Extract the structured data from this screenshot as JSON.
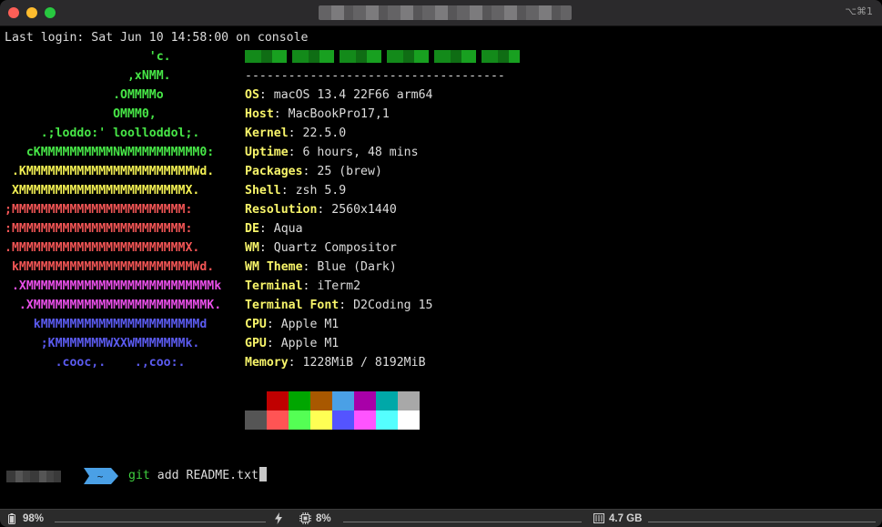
{
  "titlebar": {
    "shortcut": "⌥⌘1"
  },
  "terminal": {
    "login_line": "Last login: Sat Jun 10 14:58:00 on console",
    "logo": [
      {
        "text": "                    'c.",
        "color": "#47e647"
      },
      {
        "text": "                 ,xNMM.",
        "color": "#47e647"
      },
      {
        "text": "               .OMMMMo",
        "color": "#47e647"
      },
      {
        "text": "               OMMM0,",
        "color": "#47e647"
      },
      {
        "text": "     .;loddo:' loolloddol;.",
        "color": "#47e647"
      },
      {
        "text": "   cKMMMMMMMMMMNWMMMMMMMMMM0:",
        "color": "#47e647"
      },
      {
        "text": " .KMMMMMMMMMMMMMMMMMMMMMMMWd.",
        "color": "#f2ef52"
      },
      {
        "text": " XMMMMMMMMMMMMMMMMMMMMMMMX.",
        "color": "#f2ef52"
      },
      {
        "text": ";MMMMMMMMMMMMMMMMMMMMMMMM:",
        "color": "#f25555"
      },
      {
        "text": ":MMMMMMMMMMMMMMMMMMMMMMMM:",
        "color": "#f25555"
      },
      {
        "text": ".MMMMMMMMMMMMMMMMMMMMMMMMX.",
        "color": "#f25555"
      },
      {
        "text": " kMMMMMMMMMMMMMMMMMMMMMMMMWd.",
        "color": "#f25555"
      },
      {
        "text": " .XMMMMMMMMMMMMMMMMMMMMMMMMMMk",
        "color": "#e84fe8"
      },
      {
        "text": "  .XMMMMMMMMMMMMMMMMMMMMMMMMK.",
        "color": "#e84fe8"
      },
      {
        "text": "    kMMMMMMMMMMMMMMMMMMMMMMd",
        "color": "#5b5bf0"
      },
      {
        "text": "     ;KMMMMMMMWXXWMMMMMMMk.",
        "color": "#5b5bf0"
      },
      {
        "text": "       .cooc,.    .,coo:.",
        "color": "#5b5bf0"
      }
    ],
    "separator": "------------------------------------",
    "info": [
      {
        "key": "OS",
        "value": "macOS 13.4 22F66 arm64"
      },
      {
        "key": "Host",
        "value": "MacBookPro17,1"
      },
      {
        "key": "Kernel",
        "value": "22.5.0"
      },
      {
        "key": "Uptime",
        "value": "6 hours, 48 mins"
      },
      {
        "key": "Packages",
        "value": "25 (brew)"
      },
      {
        "key": "Shell",
        "value": "zsh 5.9"
      },
      {
        "key": "Resolution",
        "value": "2560x1440"
      },
      {
        "key": "DE",
        "value": "Aqua"
      },
      {
        "key": "WM",
        "value": "Quartz Compositor"
      },
      {
        "key": "WM Theme",
        "value": "Blue (Dark)"
      },
      {
        "key": "Terminal",
        "value": "iTerm2"
      },
      {
        "key": "Terminal Font",
        "value": "D2Coding 15"
      },
      {
        "key": "CPU",
        "value": "Apple M1"
      },
      {
        "key": "GPU",
        "value": "Apple M1"
      },
      {
        "key": "Memory",
        "value": "1228MiB / 8192MiB"
      }
    ],
    "palette": {
      "normal": [
        "#000000",
        "#c00000",
        "#00a600",
        "#a85800",
        "#4aa0e6",
        "#a800a8",
        "#00a8a8",
        "#a8a8a8"
      ],
      "bright": [
        "#555555",
        "#ff5454",
        "#54ff54",
        "#ffff54",
        "#5454ff",
        "#ff54ff",
        "#54ffff",
        "#ffffff"
      ]
    },
    "prompt": {
      "dir_symbol": "~",
      "segment_color": "#4aa0e6",
      "command_name": "git",
      "command_args": " add README.txt"
    }
  },
  "status_bar": {
    "battery": "98%",
    "cpu": "8%",
    "memory": "4.7 GB"
  }
}
